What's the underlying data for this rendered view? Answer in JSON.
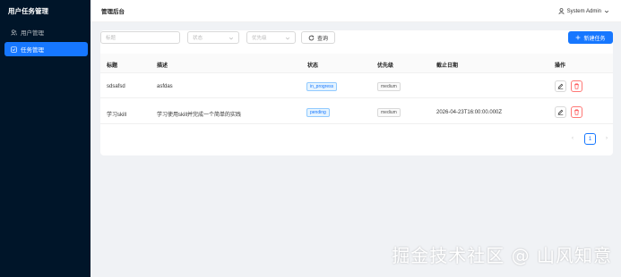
{
  "sidebar": {
    "title": "用户任务管理",
    "items": [
      {
        "label": "用户管理",
        "icon": "users-icon",
        "active": false
      },
      {
        "label": "任务管理",
        "icon": "task-icon",
        "active": true
      }
    ]
  },
  "header": {
    "breadcrumb": "管理后台",
    "user": "System Admin"
  },
  "filters": {
    "title_placeholder": "标题",
    "status_placeholder": "状态",
    "priority_placeholder": "优先级",
    "query_label": "查询",
    "new_label": "新建任务"
  },
  "table": {
    "columns": [
      "标题",
      "描述",
      "状态",
      "优先级",
      "截止日期",
      "操作"
    ],
    "rows": [
      {
        "title": "sdsafsd",
        "description": "asfdas",
        "status": "in_progress",
        "priority": "medium",
        "due": ""
      },
      {
        "title": "学习skill",
        "description": "学习使用skill并完成一个简单的实践",
        "status": "pending",
        "priority": "medium",
        "due": "2026-04-23T16:00:00.000Z"
      }
    ]
  },
  "pagination": {
    "prev": "‹",
    "current": "1",
    "next": "›"
  },
  "watermark": "掘金技术社区 @ 山风知意",
  "colors": {
    "sidebar_bg": "#001529",
    "primary": "#1677ff",
    "danger": "#ff4d4f"
  }
}
